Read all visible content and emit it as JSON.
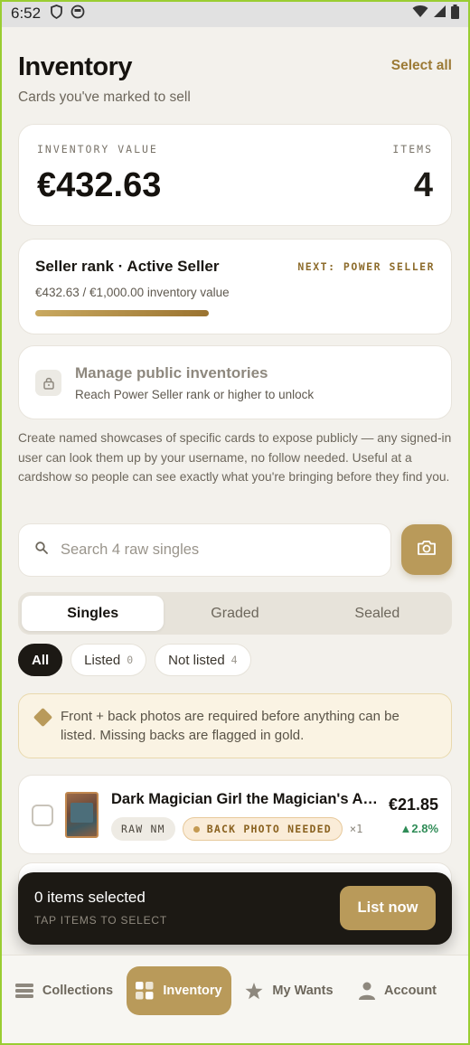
{
  "status_bar": {
    "time": "6:52"
  },
  "header": {
    "title": "Inventory",
    "subtitle": "Cards you've marked to sell",
    "select_all": "Select all"
  },
  "value_card": {
    "label": "INVENTORY VALUE",
    "value": "€432.63",
    "items_label": "ITEMS",
    "items_value": "4"
  },
  "rank_card": {
    "title": "Seller rank · Active Seller",
    "next": "NEXT: POWER SELLER",
    "sub": "€432.63 / €1,000.00 inventory value",
    "progress_fraction": 0.4326
  },
  "manage_card": {
    "title": "Manage public inventories",
    "sub": "Reach Power Seller rank or higher to unlock"
  },
  "description": "Create named showcases of specific cards to expose publicly — any signed-in user can look them up by your username, no follow needed. Useful at a cardshow so people can see exactly what you're bringing before they find you.",
  "search": {
    "placeholder": "Search 4 raw singles"
  },
  "segments": [
    {
      "label": "Singles",
      "active": true
    },
    {
      "label": "Graded",
      "active": false
    },
    {
      "label": "Sealed",
      "active": false
    }
  ],
  "filters": [
    {
      "label": "All",
      "count": "",
      "active": true
    },
    {
      "label": "Listed",
      "count": "0",
      "active": false
    },
    {
      "label": "Not listed",
      "count": "4",
      "active": false
    }
  ],
  "notice": "Front + back photos are required before anything can be listed. Missing backs are flagged in gold.",
  "items": [
    {
      "name": "Dark Magician Girl the Magician's Ap...",
      "condition": "RAW NM",
      "warning": "BACK PHOTO NEEDED",
      "qty": "×1",
      "price": "€21.85",
      "change": "▲2.8%"
    }
  ],
  "action_bar": {
    "title": "0 items selected",
    "sub": "TAP ITEMS TO SELECT",
    "button": "List now"
  },
  "nav": [
    {
      "label": "Collections",
      "icon": "collections-icon",
      "active": false
    },
    {
      "label": "Inventory",
      "icon": "inventory-grid-icon",
      "active": true
    },
    {
      "label": "My Wants",
      "icon": "star-icon",
      "active": false
    },
    {
      "label": "Account",
      "icon": "person-icon",
      "active": false
    }
  ],
  "colors": {
    "accent": "#b99a5a",
    "dark": "#1c1914",
    "positive": "#2f8c57",
    "background": "#f3f1ec"
  }
}
